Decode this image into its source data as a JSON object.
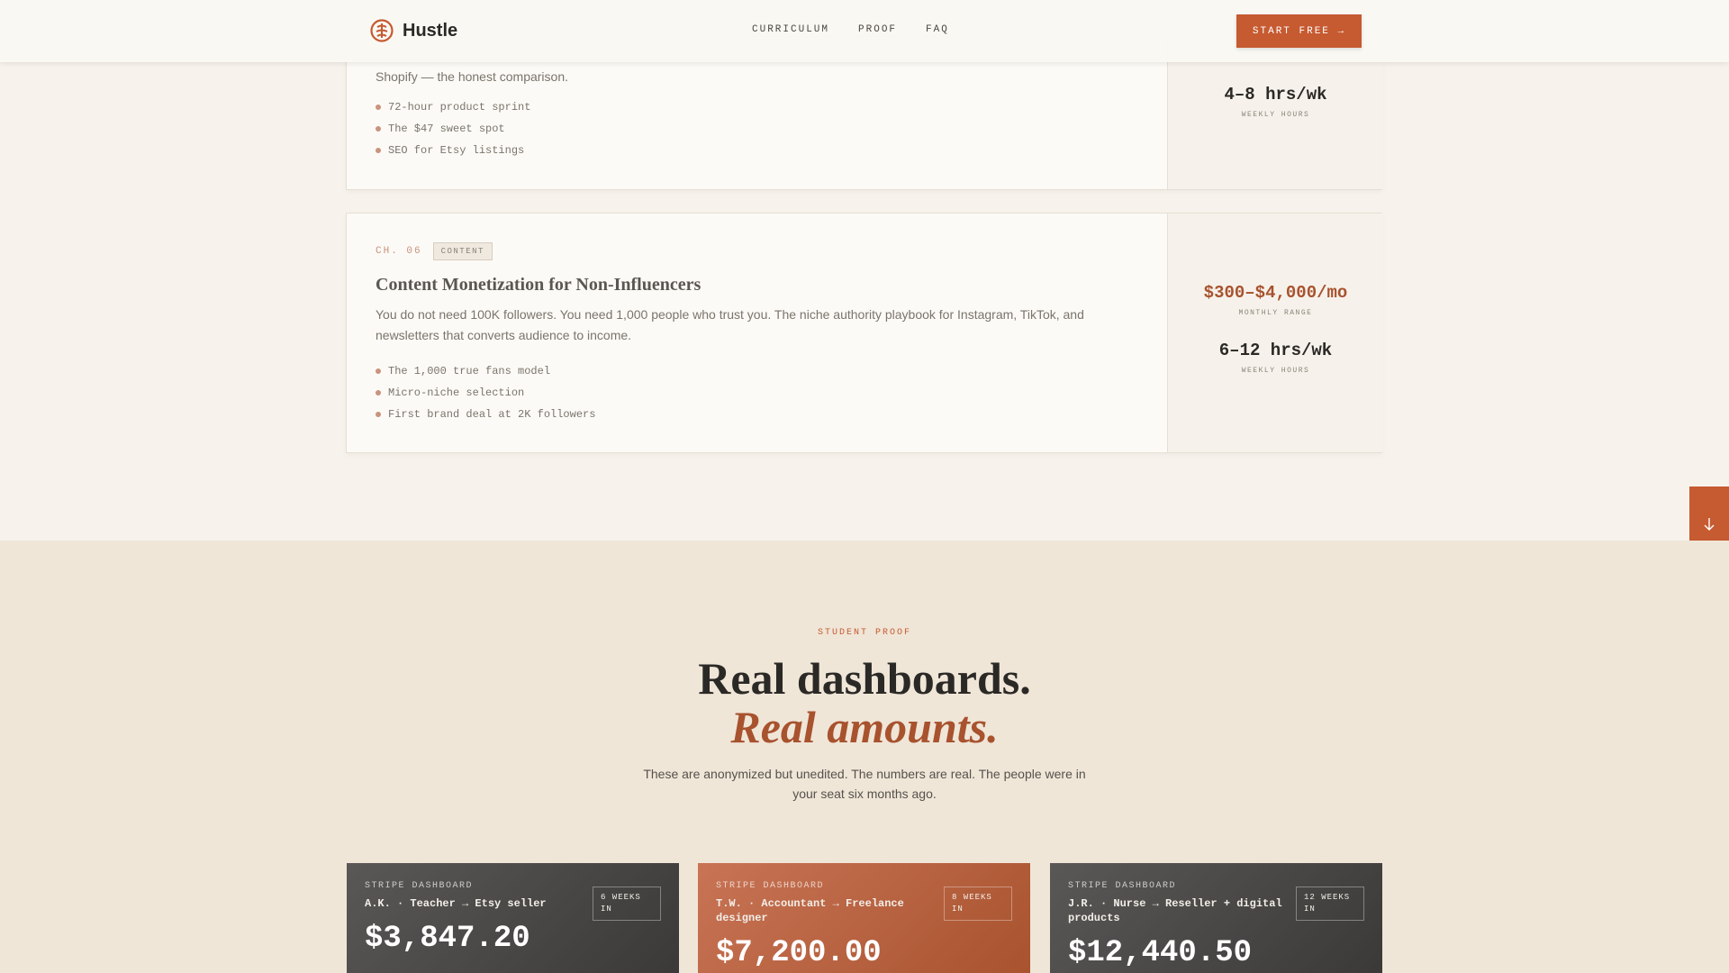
{
  "nav": {
    "brand": "Hustle",
    "links": [
      "CURRICULUM",
      "PROOF",
      "FAQ"
    ],
    "cta": "START FREE →"
  },
  "chapter5": {
    "desc_tail": "Shopify — the honest comparison.",
    "bullets": [
      "72-hour product sprint",
      "The $47 sweet spot",
      "SEO for Etsy listings"
    ],
    "hours": "4–8 hrs/wk",
    "hours_label": "WEEKLY HOURS"
  },
  "chapter6": {
    "num": "CH. 06",
    "tag": "CONTENT",
    "title": "Content Monetization for Non-Influencers",
    "desc": "You do not need 100K followers. You need 1,000 people who trust you. The niche authority playbook for Instagram, TikTok, and newsletters that converts audience to income.",
    "bullets": [
      "The 1,000 true fans model",
      "Micro-niche selection",
      "First brand deal at 2K followers"
    ],
    "range": "$300–$4,000/mo",
    "range_label": "MONTHLY RANGE",
    "hours": "6–12 hrs/wk",
    "hours_label": "WEEKLY HOURS"
  },
  "ribbon_icon": "arrow-down-icon",
  "proof": {
    "eyebrow": "STUDENT PROOF",
    "title_line1": "Real dashboards.",
    "title_line2": "Real amounts.",
    "lede": "These are anonymized but unedited. The numbers are real. The people were in your seat six months ago.",
    "dashboards": [
      {
        "source": "STRIPE DASHBOARD",
        "who": "A.K. · Teacher → Etsy seller",
        "badge": "6 WEEKS IN",
        "amount": "$3,847.20"
      },
      {
        "source": "STRIPE DASHBOARD",
        "who": "T.W. · Accountant → Freelance designer",
        "badge": "8 WEEKS IN",
        "amount": "$7,200.00"
      },
      {
        "source": "STRIPE DASHBOARD",
        "who": "J.R. · Nurse → Reseller + digital products",
        "badge": "12 WEEKS IN",
        "amount": "$12,440.50"
      }
    ]
  },
  "colors": {
    "accent": "#c65a30",
    "accent_dark": "#a8522e",
    "background": "#f7f3ec",
    "section": "#efe6d8"
  }
}
